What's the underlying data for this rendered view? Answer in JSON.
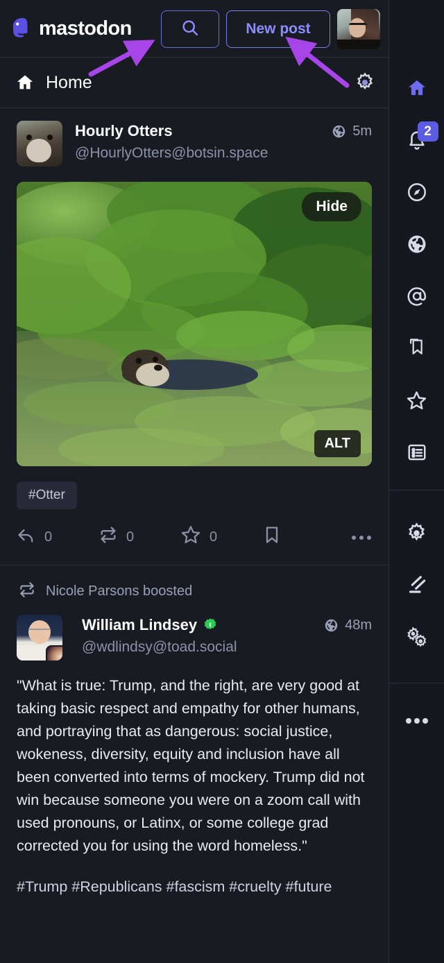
{
  "app": {
    "name": "mastodon",
    "accent": "#6364ff",
    "bg": "#191b22",
    "rail_bg": "#16181f",
    "annotation_arrow_color": "#a845e8"
  },
  "brandbar": {
    "logo_text": "mastodon",
    "logo_icon": "mastodon-logo",
    "search_icon": "search-icon",
    "new_post_label": "New post",
    "avatar": "account-avatar"
  },
  "column_header": {
    "home_icon": "home-icon",
    "title": "Home",
    "settings_icon": "gear-icon"
  },
  "statuses": [
    {
      "display_name": "Hourly Otters",
      "handle": "@HourlyOtters@botsin.space",
      "visibility_icon": "globe-icon",
      "time": "5m",
      "avatar": "otter-avatar",
      "media": {
        "hide_label": "Hide",
        "alt_label": "ALT",
        "description": "An otter swimming among lily pads in a pond"
      },
      "tags": [
        "#Otter"
      ],
      "actions": {
        "reply_icon": "reply-icon",
        "reply_count": "0",
        "boost_icon": "boost-icon",
        "boost_count": "0",
        "favourite_icon": "star-icon",
        "favourite_count": "0",
        "bookmark_icon": "bookmark-icon",
        "more_icon": "ellipsis-icon"
      }
    },
    {
      "boost_icon": "boost-icon",
      "boosted_by": "Nicole Parsons boosted",
      "display_name": "William Lindsey",
      "verified_badge": "green-check-badge",
      "handle": "@wdlindsy@toad.social",
      "visibility_icon": "globe-icon",
      "time": "48m",
      "avatar": "william-lindsey-avatar",
      "text": "\"What is true: Trump, and the right, are very good at taking basic respect and empathy for other humans, and portraying that as dangerous: social justice, wokeness, diversity, equity and inclusion have all been converted into terms of mockery. Trump did not win because someone you were on a zoom call with used pronouns, or Latinx, or some college grad corrected you for using the word homeless.\"",
      "tags_line": "#Trump #Republicans #fascism #cruelty #future"
    }
  ],
  "rail": {
    "items": [
      {
        "name": "home",
        "icon": "home-icon",
        "active": true
      },
      {
        "name": "notifications",
        "icon": "bell-icon",
        "badge": "2"
      },
      {
        "name": "explore",
        "icon": "compass-icon"
      },
      {
        "name": "live-feeds",
        "icon": "globe-icon"
      },
      {
        "name": "private-mentions",
        "icon": "at-icon"
      },
      {
        "name": "bookmarks",
        "icon": "bookmark-icon"
      },
      {
        "name": "favourites",
        "icon": "star-icon"
      },
      {
        "name": "lists",
        "icon": "list-icon"
      },
      {
        "name": "settings",
        "icon": "gear-icon"
      },
      {
        "name": "moderation",
        "icon": "gavel-icon"
      },
      {
        "name": "administration",
        "icon": "gears-icon"
      },
      {
        "name": "more",
        "icon": "ellipsis-icon"
      }
    ]
  }
}
